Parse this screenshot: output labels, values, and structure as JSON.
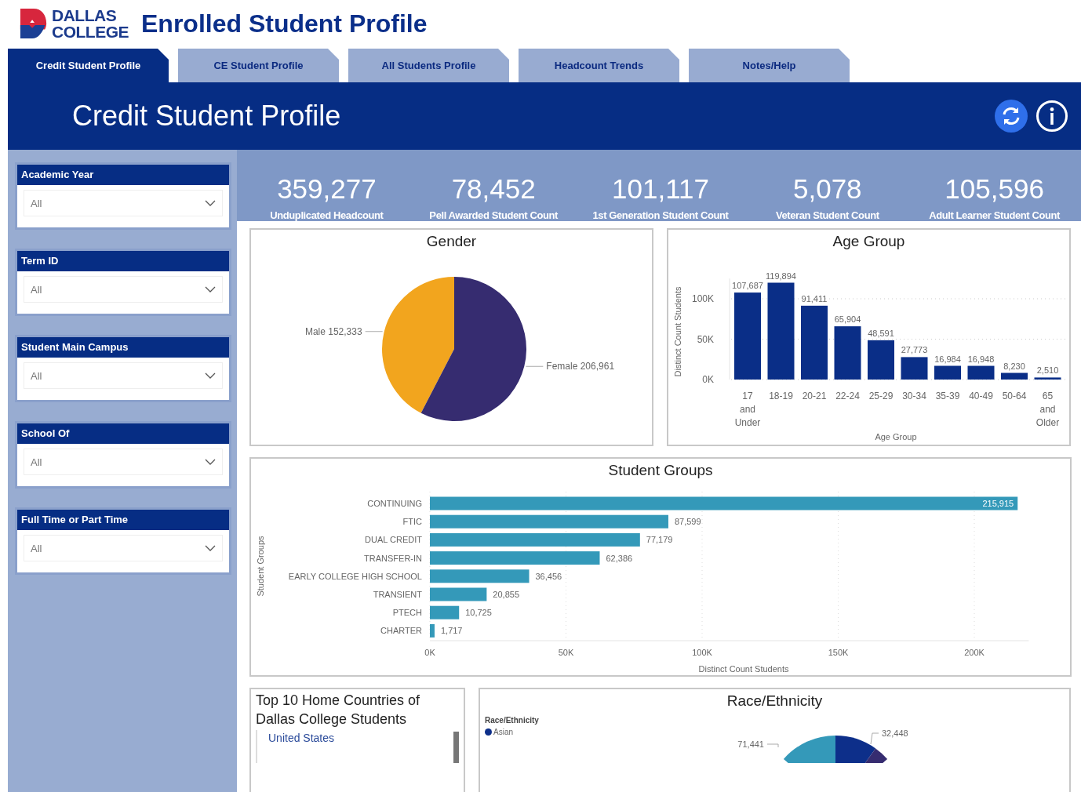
{
  "header": {
    "logo_lines": [
      "DALLAS",
      "COLLEGE"
    ],
    "title": "Enrolled Student Profile"
  },
  "tabs": [
    {
      "label": "Credit Student Profile",
      "selected": true
    },
    {
      "label": "CE Student Profile",
      "selected": false
    },
    {
      "label": "All Students Profile",
      "selected": false
    },
    {
      "label": "Headcount Trends",
      "selected": false
    },
    {
      "label": "Notes/Help",
      "selected": false
    }
  ],
  "banner": {
    "title": "Credit Student Profile"
  },
  "filters": [
    {
      "label": "Academic Year",
      "value": "All"
    },
    {
      "label": "Term ID",
      "value": "All"
    },
    {
      "label": "Student Main Campus",
      "value": "All"
    },
    {
      "label": "School Of",
      "value": "All"
    },
    {
      "label": "Full Time or Part Time",
      "value": "All"
    }
  ],
  "kpis": [
    {
      "value": "359,277",
      "label": "Unduplicated Headcount"
    },
    {
      "value": "78,452",
      "label": "Pell Awarded Student Count"
    },
    {
      "value": "101,117",
      "label": "1st Generation Student Count"
    },
    {
      "value": "5,078",
      "label": "Veteran Student Count"
    },
    {
      "value": "105,596",
      "label": "Adult Learner Student Count"
    }
  ],
  "gender": {
    "chart_data": {
      "type": "pie",
      "title": "Gender",
      "categories": [
        "Male",
        "Female"
      ],
      "values": [
        152333,
        206961
      ],
      "colors": [
        "#f2a51e",
        "#362c70"
      ],
      "value_labels": [
        "152,333",
        "206,961"
      ]
    }
  },
  "age": {
    "chart_data": {
      "type": "bar",
      "title": "Age Group",
      "xlabel": "Age Group",
      "ylabel": "Distinct Count Students",
      "categories": [
        "17 and Under",
        "18-19",
        "20-21",
        "22-24",
        "25-29",
        "30-34",
        "35-39",
        "40-49",
        "50-64",
        "65 and Older"
      ],
      "series": [
        {
          "color": "#0a2e87",
          "values": [
            107687,
            119894,
            91411,
            65904,
            48591,
            27773,
            16984,
            16948,
            8230,
            2510
          ]
        }
      ],
      "grid": true,
      "ylim": [
        0,
        125000
      ],
      "yticks": [
        {
          "value": 0,
          "label": "0K"
        },
        {
          "value": 50000,
          "label": "50K"
        },
        {
          "value": 100000,
          "label": "100K"
        }
      ],
      "value_labels": [
        "107,687",
        "119,894",
        "91,411",
        "65,904",
        "48,591",
        "27,773",
        "16,984",
        "16,948",
        "8,230",
        "2,510"
      ]
    }
  },
  "groups": {
    "chart_data": {
      "type": "bar",
      "orientation": "horizontal",
      "title": "Student Groups",
      "xlabel": "Distinct Count Students",
      "ylabel": "Student Groups",
      "categories": [
        "CONTINUING",
        "FTIC",
        "DUAL CREDIT",
        "TRANSFER-IN",
        "EARLY COLLEGE HIGH SCHOOL",
        "TRANSIENT",
        "PTECH",
        "CHARTER"
      ],
      "series": [
        {
          "color": "#3499b9",
          "values": [
            215915,
            87599,
            77179,
            62386,
            36456,
            20855,
            10725,
            1717
          ]
        }
      ],
      "grid": true,
      "xlim": [
        0,
        220000
      ],
      "xticks": [
        {
          "value": 0,
          "label": "0K"
        },
        {
          "value": 50000,
          "label": "50K"
        },
        {
          "value": 100000,
          "label": "100K"
        },
        {
          "value": 150000,
          "label": "150K"
        },
        {
          "value": 200000,
          "label": "200K"
        }
      ],
      "value_labels": [
        "215,915",
        "87,599",
        "77,179",
        "62,386",
        "36,456",
        "20,855",
        "10,725",
        "1,717"
      ]
    }
  },
  "countries": {
    "title": "Top 10 Home Countries of Dallas College Students",
    "items": [
      "United States"
    ]
  },
  "race": {
    "title": "Race/Ethnicity",
    "legend_title": "Race/Ethnicity",
    "legend": [
      {
        "name": "Asian",
        "color": "#0d2f8a"
      }
    ],
    "data_labels": [
      "32,448",
      "71,441"
    ]
  }
}
